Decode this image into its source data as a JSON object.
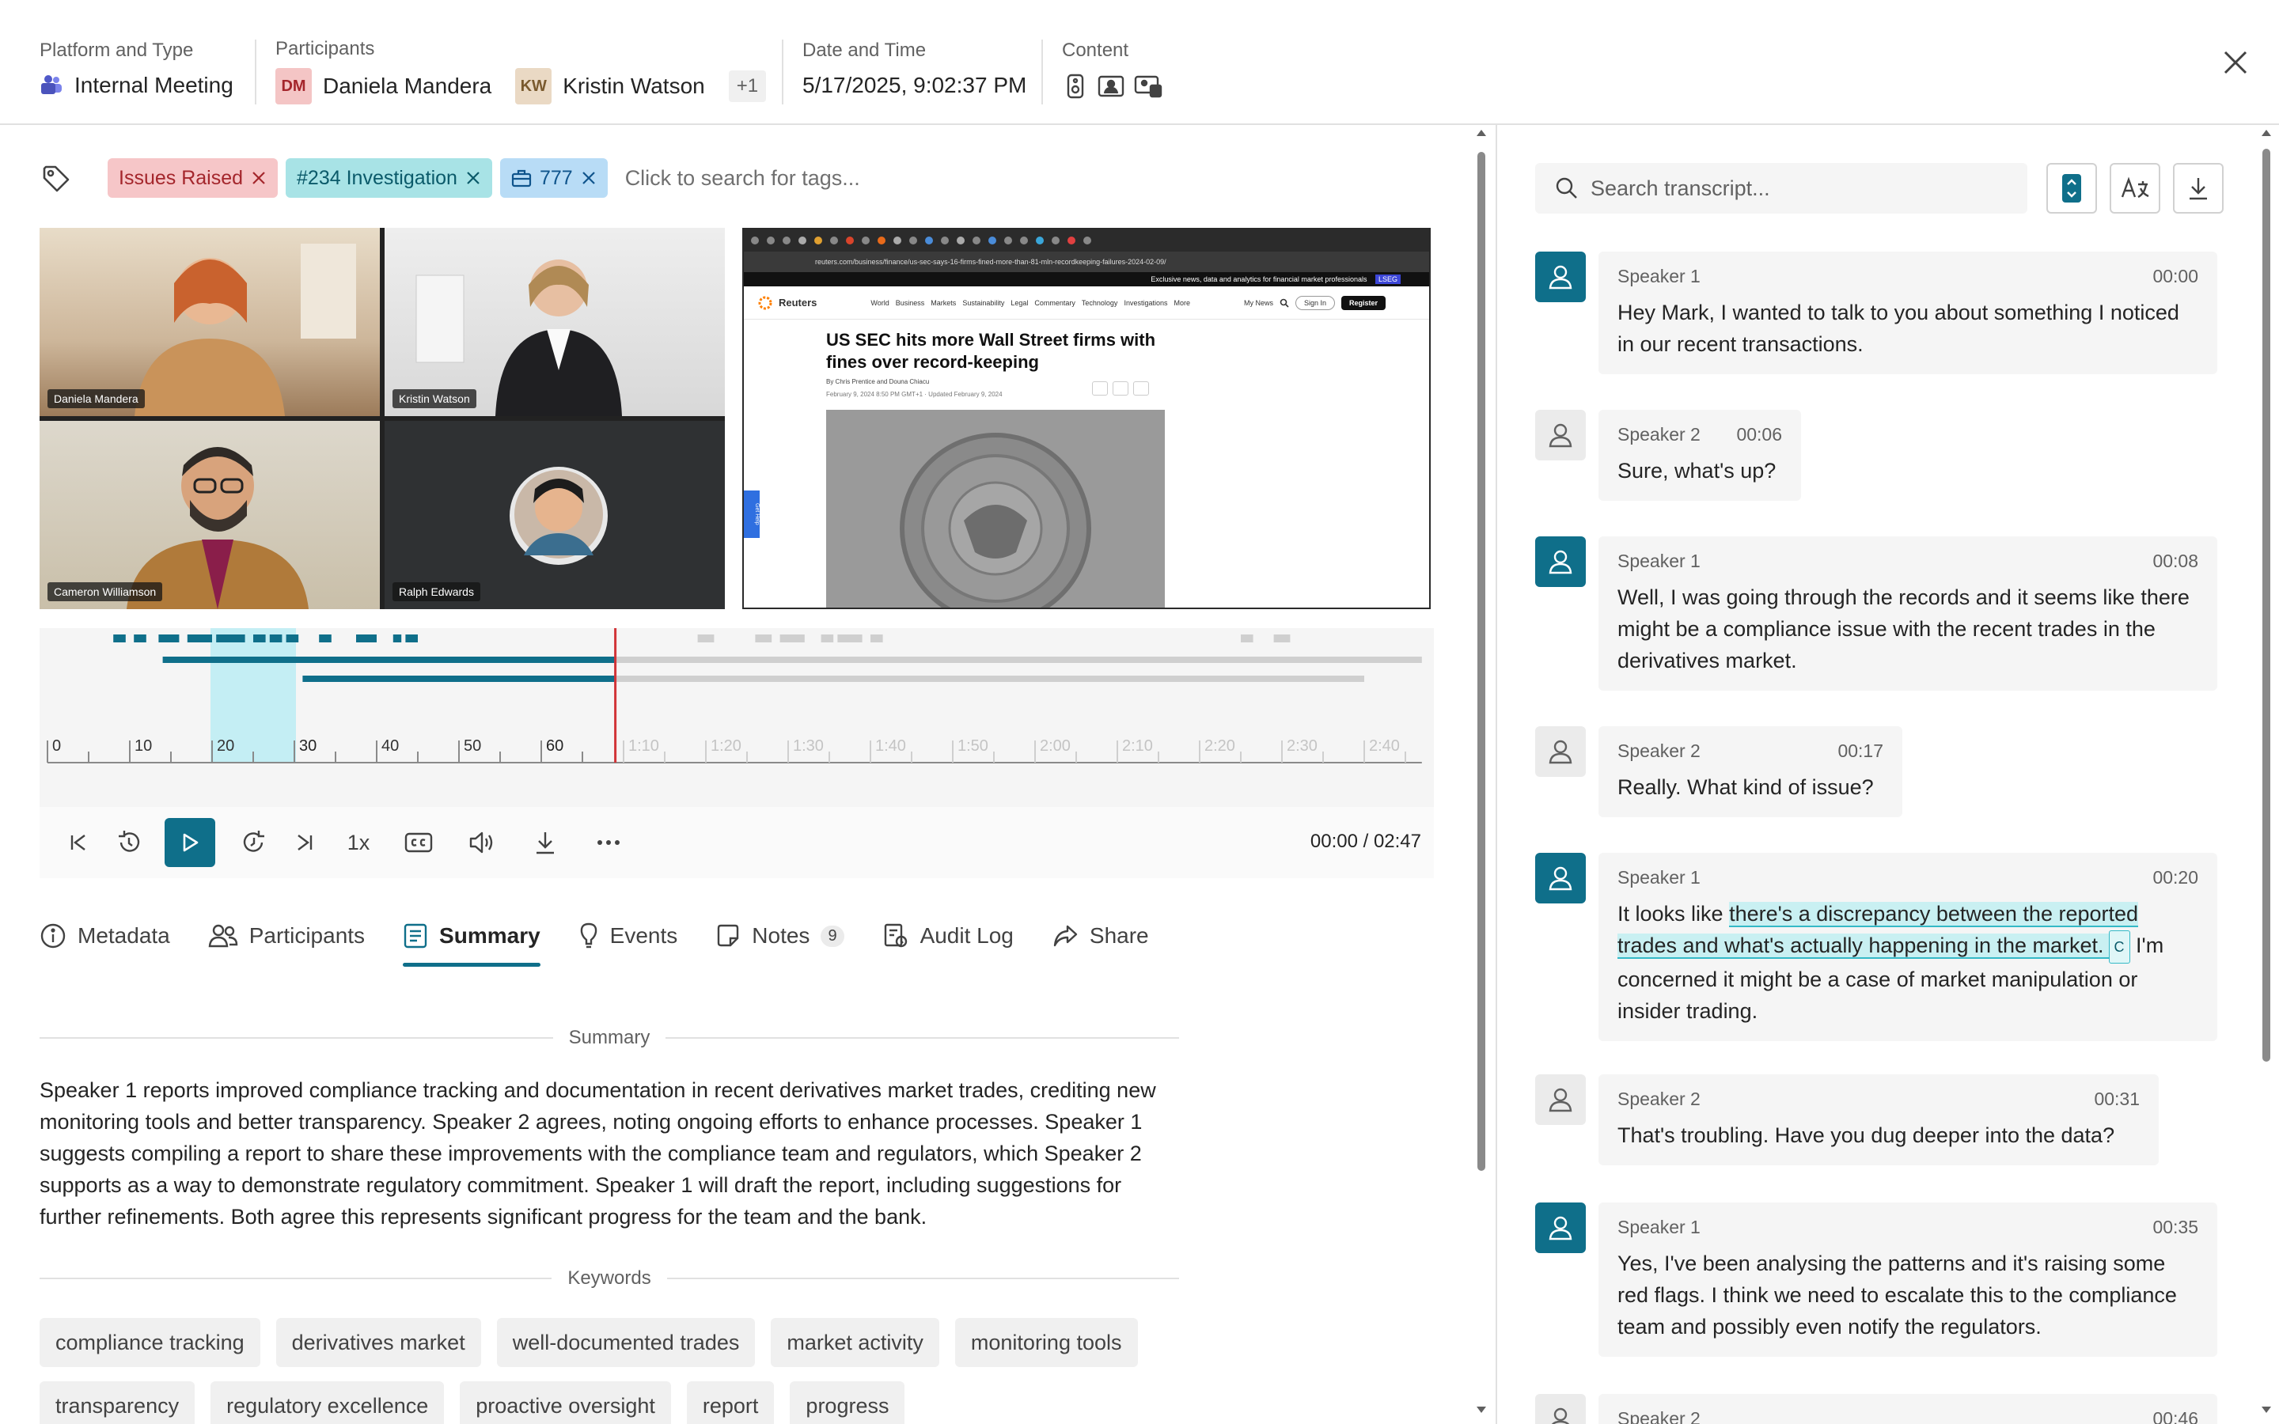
{
  "header": {
    "platform": {
      "label": "Platform and Type",
      "value": "Internal Meeting"
    },
    "participants": {
      "label": "Participants",
      "people": [
        {
          "initials": "DM",
          "name": "Daniela Mandera"
        },
        {
          "initials": "KW",
          "name": "Kristin Watson"
        }
      ],
      "more": "+1"
    },
    "datetime": {
      "label": "Date and Time",
      "value": "5/17/2025, 9:02:37 PM"
    },
    "content": {
      "label": "Content"
    }
  },
  "tags": {
    "items": [
      "Issues Raised",
      "#234 Investigation",
      "777"
    ],
    "placeholder": "Click to search for tags..."
  },
  "video": {
    "tiles": [
      "Daniela Mandera",
      "Kristin Watson",
      "Cameron Williamson",
      "Ralph Edwards"
    ]
  },
  "shared_screen": {
    "site": "Reuters",
    "url": "reuters.com/business/finance/us-sec-says-16-firms-fined-more-than-81-mln-recordkeeping-failures-2024-02-09/",
    "banner": "Exclusive news, data and analytics for financial market professionals",
    "banner_badge": "LSEG",
    "nav": [
      "World",
      "Business",
      "Markets",
      "Sustainability",
      "Legal",
      "Commentary",
      "Technology",
      "Investigations",
      "More"
    ],
    "my_news": "My News",
    "sign_in": "Sign In",
    "register": "Register",
    "headline": "US SEC hits more Wall Street firms with fines over record-keeping",
    "byline": "By Chris Prentice and Douna Chiacu",
    "dateline": "February 9, 2024 8:50 PM GMT+1 · Updated February 9, 2024",
    "side_tab": "Get Help"
  },
  "timeline": {
    "ticks": [
      "0",
      "10",
      "20",
      "30",
      "40",
      "50",
      "60",
      "1:10",
      "1:20",
      "1:30",
      "1:40",
      "1:50",
      "2:00",
      "2:10",
      "2:20",
      "2:30",
      "2:40"
    ],
    "major_ticks": [
      "30",
      "60",
      "1:30",
      "2:00",
      "2:30"
    ],
    "playhead_seconds": 69,
    "duration_seconds": 167,
    "selection_seconds": [
      20,
      30
    ]
  },
  "player": {
    "speed": "1x",
    "time": "00:00 / 02:47"
  },
  "tabs": [
    {
      "label": "Metadata",
      "icon": "info-icon"
    },
    {
      "label": "Participants",
      "icon": "people-icon"
    },
    {
      "label": "Summary",
      "icon": "summary-icon",
      "active": true
    },
    {
      "label": "Events",
      "icon": "lightbulb-icon"
    },
    {
      "label": "Notes",
      "icon": "note-icon",
      "badge": "9"
    },
    {
      "label": "Audit Log",
      "icon": "audit-icon"
    },
    {
      "label": "Share",
      "icon": "share-icon"
    }
  ],
  "summary": {
    "heading": "Summary",
    "text": "Speaker 1 reports improved compliance tracking and documentation in recent derivatives market trades, crediting new monitoring tools and better transparency. Speaker 2 agrees, noting ongoing efforts to enhance processes. Speaker 1 suggests compiling a report to share these improvements with the compliance team and regulators, which Speaker 2 supports as a way to demonstrate regulatory commitment. Speaker 1 will draft the report, including suggestions for further refinements. Both agree this represents significant progress for the team and the bank.",
    "keywords_heading": "Keywords",
    "keywords": [
      "compliance tracking",
      "derivatives market",
      "well-documented trades",
      "market activity",
      "monitoring tools",
      "transparency",
      "regulatory excellence",
      "proactive oversight",
      "report",
      "progress"
    ]
  },
  "transcript": {
    "search_placeholder": "Search transcript...",
    "messages": [
      {
        "speaker": "Speaker 1",
        "time": "00:00",
        "text": "Hey Mark, I wanted to talk to you about something I noticed in our recent transactions."
      },
      {
        "speaker": "Speaker 2",
        "time": "00:06",
        "text": "Sure, what's up?"
      },
      {
        "speaker": "Speaker 1",
        "time": "00:08",
        "text": "Well, I was going through the records and it seems like there might be a compliance issue with the recent trades in the derivatives market."
      },
      {
        "speaker": "Speaker 2",
        "time": "00:17",
        "text": "Really. What kind of issue?"
      },
      {
        "speaker": "Speaker 1",
        "time": "00:20",
        "pre": "It looks like ",
        "highlight": "there's a discrepancy between the reported trades and what's actually happening in the market.",
        "badge": "C",
        "post": " I'm concerned it might be a case of market manipulation or insider trading."
      },
      {
        "speaker": "Speaker 2",
        "time": "00:31",
        "text": "That's troubling. Have you dug deeper into the data?"
      },
      {
        "speaker": "Speaker 1",
        "time": "00:35",
        "text": "Yes, I've been analysing the patterns and it's raising some red flags. I think we need to escalate this to the compliance team and possibly even notify the regulators."
      },
      {
        "speaker": "Speaker 2",
        "time": "00:46",
        "text": ""
      }
    ]
  },
  "colors": {
    "accent": "#0f6f8a",
    "tag_red": "#f6c6c8",
    "tag_teal": "#a8e3e6",
    "tag_blue": "#b8dcf6",
    "playhead": "#d13438",
    "timeline_selection": "#c4eef4"
  }
}
